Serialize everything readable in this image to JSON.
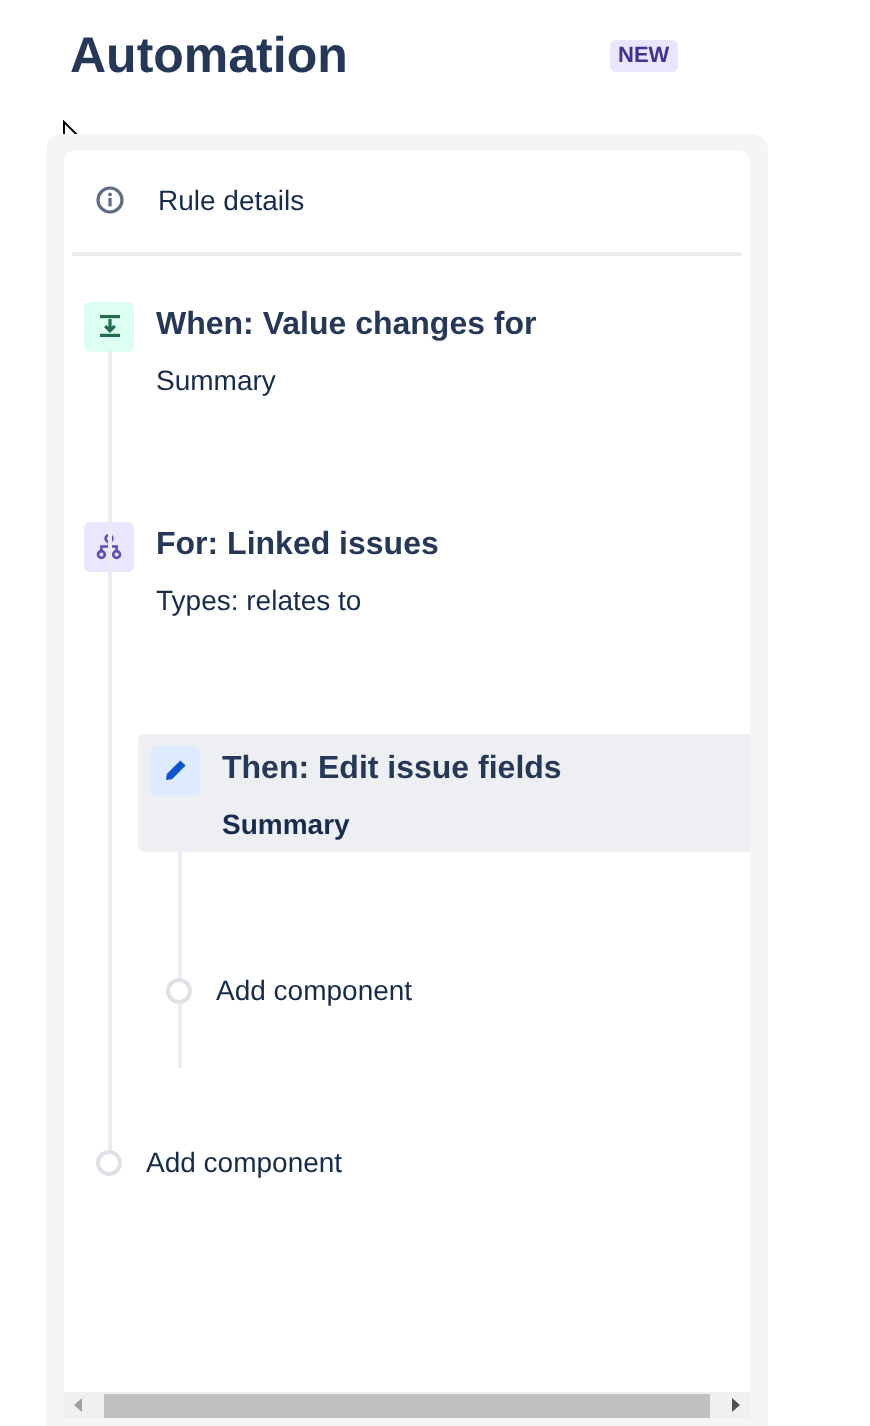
{
  "header": {
    "title": "Automation",
    "badge": "NEW"
  },
  "rule_details": {
    "label": "Rule details"
  },
  "steps": [
    {
      "kind": "trigger",
      "title": "When: Value changes for",
      "detail": "Summary"
    },
    {
      "kind": "branch",
      "title": "For: Linked issues",
      "detail": "Types: relates to",
      "children": [
        {
          "kind": "action",
          "title": "Then: Edit issue fields",
          "detail": "Summary",
          "selected": true
        },
        {
          "kind": "add",
          "label": "Add component"
        }
      ]
    },
    {
      "kind": "add",
      "label": "Add component"
    }
  ]
}
